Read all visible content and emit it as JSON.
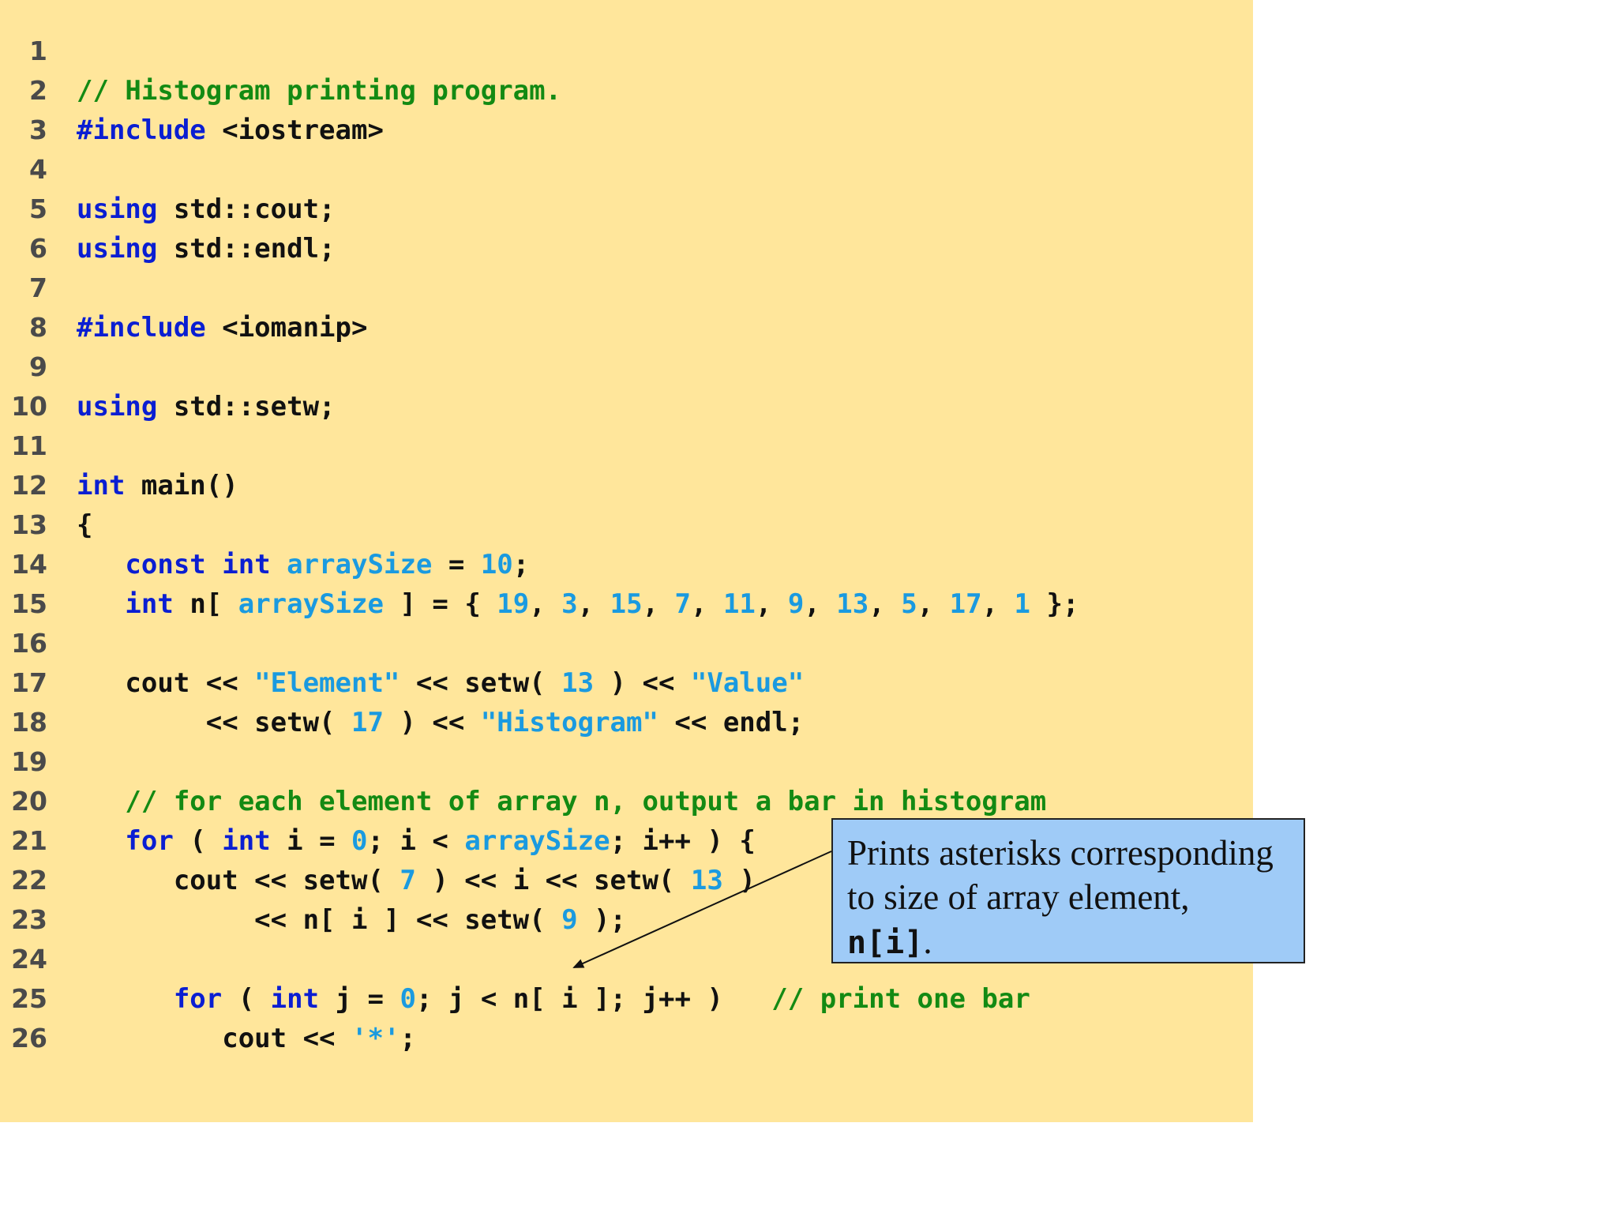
{
  "colors": {
    "panel_background": "#ffe69b",
    "keyword": "#0a1ed2",
    "comment": "#138a13",
    "literal": "#1a9ae0",
    "callout_background": "#9fcbf7"
  },
  "code_lines": [
    {
      "n": "1",
      "tokens": []
    },
    {
      "n": "2",
      "tokens": [
        {
          "c": "cm",
          "t": "// Histogram printing program."
        }
      ]
    },
    {
      "n": "3",
      "tokens": [
        {
          "c": "kw",
          "t": "#include"
        },
        {
          "c": "p",
          "t": " <iostream>"
        }
      ]
    },
    {
      "n": "4",
      "tokens": []
    },
    {
      "n": "5",
      "tokens": [
        {
          "c": "kw",
          "t": "using"
        },
        {
          "c": "p",
          "t": " std::cout;"
        }
      ]
    },
    {
      "n": "6",
      "tokens": [
        {
          "c": "kw",
          "t": "using"
        },
        {
          "c": "p",
          "t": " std::endl;"
        }
      ]
    },
    {
      "n": "7",
      "tokens": []
    },
    {
      "n": "8",
      "tokens": [
        {
          "c": "kw",
          "t": "#include"
        },
        {
          "c": "p",
          "t": " <iomanip>"
        }
      ]
    },
    {
      "n": "9",
      "tokens": []
    },
    {
      "n": "10",
      "tokens": [
        {
          "c": "kw",
          "t": "using"
        },
        {
          "c": "p",
          "t": " std::setw;"
        }
      ]
    },
    {
      "n": "11",
      "tokens": []
    },
    {
      "n": "12",
      "tokens": [
        {
          "c": "kw",
          "t": "int"
        },
        {
          "c": "p",
          "t": " main()"
        }
      ]
    },
    {
      "n": "13",
      "tokens": [
        {
          "c": "p",
          "t": "{"
        }
      ]
    },
    {
      "n": "14",
      "tokens": [
        {
          "c": "p",
          "t": "   "
        },
        {
          "c": "kw",
          "t": "const"
        },
        {
          "c": "p",
          "t": " "
        },
        {
          "c": "kw",
          "t": "int"
        },
        {
          "c": "p",
          "t": " "
        },
        {
          "c": "id",
          "t": "arraySize"
        },
        {
          "c": "p",
          "t": " = "
        },
        {
          "c": "num",
          "t": "10"
        },
        {
          "c": "p",
          "t": ";"
        }
      ]
    },
    {
      "n": "15",
      "tokens": [
        {
          "c": "p",
          "t": "   "
        },
        {
          "c": "kw",
          "t": "int"
        },
        {
          "c": "p",
          "t": " n[ "
        },
        {
          "c": "id",
          "t": "arraySize"
        },
        {
          "c": "p",
          "t": " ] = { "
        },
        {
          "c": "num",
          "t": "19"
        },
        {
          "c": "p",
          "t": ", "
        },
        {
          "c": "num",
          "t": "3"
        },
        {
          "c": "p",
          "t": ", "
        },
        {
          "c": "num",
          "t": "15"
        },
        {
          "c": "p",
          "t": ", "
        },
        {
          "c": "num",
          "t": "7"
        },
        {
          "c": "p",
          "t": ", "
        },
        {
          "c": "num",
          "t": "11"
        },
        {
          "c": "p",
          "t": ", "
        },
        {
          "c": "num",
          "t": "9"
        },
        {
          "c": "p",
          "t": ", "
        },
        {
          "c": "num",
          "t": "13"
        },
        {
          "c": "p",
          "t": ", "
        },
        {
          "c": "num",
          "t": "5"
        },
        {
          "c": "p",
          "t": ", "
        },
        {
          "c": "num",
          "t": "17"
        },
        {
          "c": "p",
          "t": ", "
        },
        {
          "c": "num",
          "t": "1"
        },
        {
          "c": "p",
          "t": " };"
        }
      ]
    },
    {
      "n": "16",
      "tokens": []
    },
    {
      "n": "17",
      "tokens": [
        {
          "c": "p",
          "t": "   cout << "
        },
        {
          "c": "str",
          "t": "\"Element\""
        },
        {
          "c": "p",
          "t": " << setw( "
        },
        {
          "c": "num",
          "t": "13"
        },
        {
          "c": "p",
          "t": " ) << "
        },
        {
          "c": "str",
          "t": "\"Value\""
        }
      ]
    },
    {
      "n": "18",
      "tokens": [
        {
          "c": "p",
          "t": "        << setw( "
        },
        {
          "c": "num",
          "t": "17"
        },
        {
          "c": "p",
          "t": " ) << "
        },
        {
          "c": "str",
          "t": "\"Histogram\""
        },
        {
          "c": "p",
          "t": " << endl;"
        }
      ]
    },
    {
      "n": "19",
      "tokens": []
    },
    {
      "n": "20",
      "tokens": [
        {
          "c": "p",
          "t": "   "
        },
        {
          "c": "cm",
          "t": "// for each element of array n, output a bar in histogram"
        }
      ]
    },
    {
      "n": "21",
      "tokens": [
        {
          "c": "p",
          "t": "   "
        },
        {
          "c": "kw",
          "t": "for"
        },
        {
          "c": "p",
          "t": " ( "
        },
        {
          "c": "kw",
          "t": "int"
        },
        {
          "c": "p",
          "t": " i = "
        },
        {
          "c": "num",
          "t": "0"
        },
        {
          "c": "p",
          "t": "; i < "
        },
        {
          "c": "id",
          "t": "arraySize"
        },
        {
          "c": "p",
          "t": "; i++ ) {"
        }
      ]
    },
    {
      "n": "22",
      "tokens": [
        {
          "c": "p",
          "t": "      cout << setw( "
        },
        {
          "c": "num",
          "t": "7"
        },
        {
          "c": "p",
          "t": " ) << i << setw( "
        },
        {
          "c": "num",
          "t": "13"
        },
        {
          "c": "p",
          "t": " )"
        }
      ]
    },
    {
      "n": "23",
      "tokens": [
        {
          "c": "p",
          "t": "           << n[ i ] << setw( "
        },
        {
          "c": "num",
          "t": "9"
        },
        {
          "c": "p",
          "t": " );"
        }
      ]
    },
    {
      "n": "24",
      "tokens": []
    },
    {
      "n": "25",
      "tokens": [
        {
          "c": "p",
          "t": "      "
        },
        {
          "c": "kw",
          "t": "for"
        },
        {
          "c": "p",
          "t": " ( "
        },
        {
          "c": "kw",
          "t": "int"
        },
        {
          "c": "p",
          "t": " j = "
        },
        {
          "c": "num",
          "t": "0"
        },
        {
          "c": "p",
          "t": "; j < n[ i ]; j++ )   "
        },
        {
          "c": "cm",
          "t": "// print one bar"
        }
      ]
    },
    {
      "n": "26",
      "tokens": [
        {
          "c": "p",
          "t": "         cout << "
        },
        {
          "c": "str",
          "t": "'*'"
        },
        {
          "c": "p",
          "t": ";"
        }
      ]
    }
  ],
  "callout": {
    "line1": "Prints asterisks corresponding",
    "line2": "to size of array element,",
    "code_ref": "n[i]",
    "trailing": "."
  }
}
